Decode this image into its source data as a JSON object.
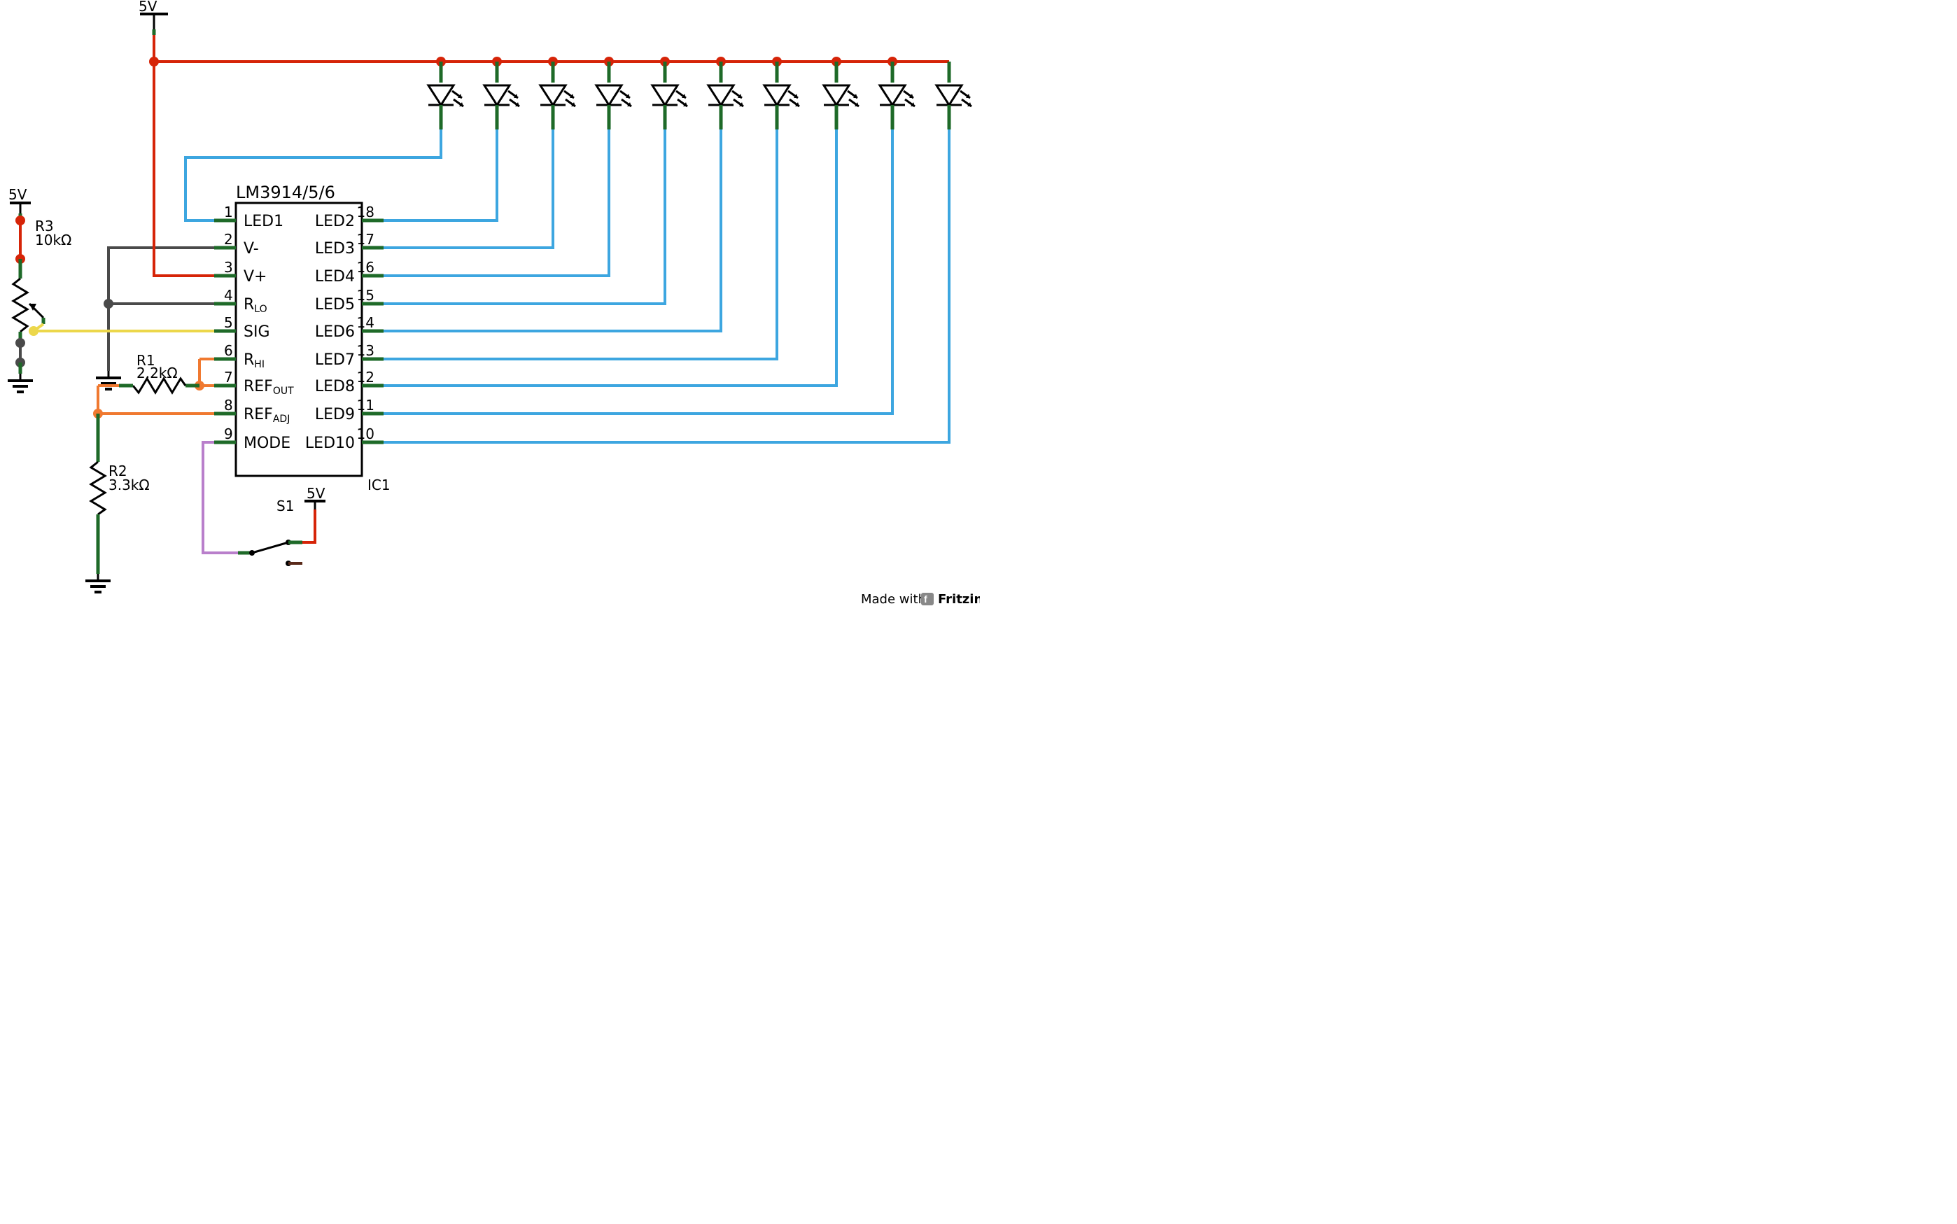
{
  "power_labels": {
    "top_main": "5V",
    "top_left": "5V",
    "switch_supply": "5V"
  },
  "ic": {
    "title": "LM3914/5/6",
    "ref": "IC1",
    "pins_left": [
      {
        "num": "1",
        "name": "LED1"
      },
      {
        "num": "2",
        "name": "V-"
      },
      {
        "num": "3",
        "name": "V+"
      },
      {
        "num": "4",
        "name": "R",
        "sub": "LO"
      },
      {
        "num": "5",
        "name": "SIG"
      },
      {
        "num": "6",
        "name": "R",
        "sub": "HI"
      },
      {
        "num": "7",
        "name": "REF",
        "sub": "OUT"
      },
      {
        "num": "8",
        "name": "REF",
        "sub": "ADJ"
      },
      {
        "num": "9",
        "name": "MODE"
      }
    ],
    "pins_right": [
      {
        "num": "18",
        "name": "LED2"
      },
      {
        "num": "17",
        "name": "LED3"
      },
      {
        "num": "16",
        "name": "LED4"
      },
      {
        "num": "15",
        "name": "LED5"
      },
      {
        "num": "14",
        "name": "LED6"
      },
      {
        "num": "13",
        "name": "LED7"
      },
      {
        "num": "12",
        "name": "LED8"
      },
      {
        "num": "11",
        "name": "LED9"
      },
      {
        "num": "10",
        "name": "LED10"
      }
    ]
  },
  "components": {
    "r1": {
      "name": "R1",
      "value": "2.2kΩ"
    },
    "r2": {
      "name": "R2",
      "value": "3.3kΩ"
    },
    "r3": {
      "name": "R3",
      "value": "10kΩ"
    },
    "s1": {
      "name": "S1"
    }
  },
  "footer": {
    "text": "Made with",
    "brand": "Fritzing.org"
  }
}
